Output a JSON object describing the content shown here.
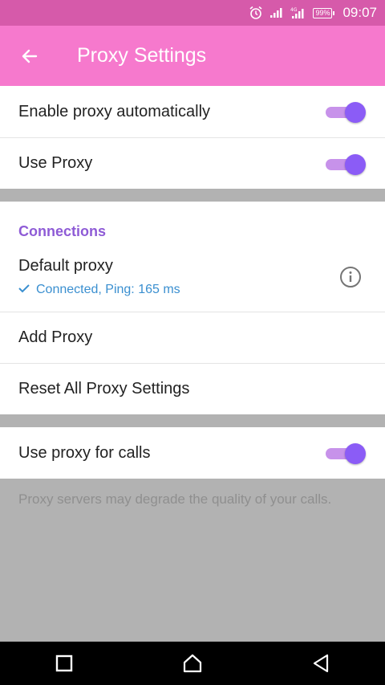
{
  "status_bar": {
    "battery": "99%",
    "time": "09:07",
    "icons": [
      "alarm-icon",
      "signal-icon",
      "signal-4g-icon",
      "battery-icon"
    ]
  },
  "app_bar": {
    "title": "Proxy Settings",
    "back_icon": "back-arrow-icon"
  },
  "settings": {
    "enable_auto": {
      "label": "Enable proxy automatically",
      "enabled": true
    },
    "use_proxy": {
      "label": "Use Proxy",
      "enabled": true
    }
  },
  "connections": {
    "title": "Connections",
    "default_proxy": {
      "name": "Default proxy",
      "status": "Connected, Ping: 165 ms"
    },
    "add_proxy": "Add Proxy",
    "reset": "Reset All Proxy Settings"
  },
  "calls": {
    "label": "Use proxy for calls",
    "enabled": true,
    "note": "Proxy servers may degrade the quality of your calls."
  },
  "colors": {
    "app_bar": "#f679cd",
    "status_bar": "#d65aaa",
    "accent": "#8b5cf6",
    "section_title": "#8e5bd6",
    "connected": "#3a8fd0"
  },
  "nav_bar": [
    "recents-square-icon",
    "home-icon",
    "back-triangle-icon"
  ]
}
